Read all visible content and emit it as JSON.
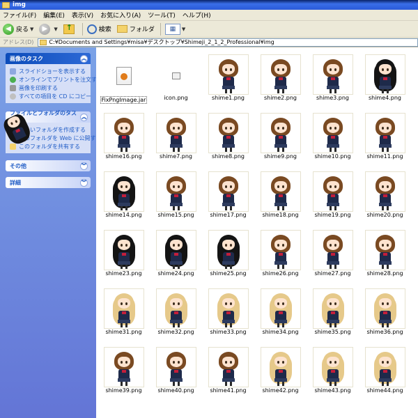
{
  "window": {
    "title": "img"
  },
  "menu": [
    "ファイル(F)",
    "編集(E)",
    "表示(V)",
    "お気に入り(A)",
    "ツール(T)",
    "ヘルプ(H)"
  ],
  "toolbar": {
    "back_label": "戻る",
    "search_label": "検索",
    "folders_label": "フォルダ"
  },
  "address": {
    "label": "アドレス(D)",
    "path": "C:¥Documents and Settings¥misa¥デスクトップ¥Shimeji_2_1_2_Professional¥img"
  },
  "left": {
    "image_tasks": {
      "title": "画像のタスク",
      "links": [
        "スライドショーを表示する",
        "オンラインでプリントを注文する",
        "画像を印刷する",
        "すべての項目を CD にコピー"
      ]
    },
    "file_tasks": {
      "title": "ファイルとフォルダのタスク",
      "links": [
        "新しいフォルダを作成する",
        "このフォルダを Web に公開する",
        "このフォルダを共有する"
      ]
    },
    "other": {
      "title": "その他"
    },
    "details": {
      "title": "詳細"
    }
  },
  "colors": {
    "brown_hair": "#7a4a22",
    "black_hair": "#141414",
    "blonde_hair": "#e6c98a",
    "selection": "#316ac5"
  },
  "files": [
    {
      "name": "FixPngImage.jar",
      "kind": "jar"
    },
    {
      "name": "icon.png",
      "kind": "png"
    },
    {
      "name": "shime1.png",
      "kind": "brown"
    },
    {
      "name": "shime2.png",
      "kind": "brown"
    },
    {
      "name": "shime3.png",
      "kind": "brown"
    },
    {
      "name": "shime4.png",
      "kind": "black"
    },
    {
      "name": "shime16.png",
      "kind": "brown"
    },
    {
      "name": "shime7.png",
      "kind": "brown"
    },
    {
      "name": "shime8.png",
      "kind": "brown"
    },
    {
      "name": "shime9.png",
      "kind": "brown"
    },
    {
      "name": "shime10.png",
      "kind": "brown"
    },
    {
      "name": "shime11.png",
      "kind": "brown"
    },
    {
      "name": "shime14.png",
      "kind": "black"
    },
    {
      "name": "shime15.png",
      "kind": "brown"
    },
    {
      "name": "shime17.png",
      "kind": "brown"
    },
    {
      "name": "shime18.png",
      "kind": "brown"
    },
    {
      "name": "shime19.png",
      "kind": "brown"
    },
    {
      "name": "shime20.png",
      "kind": "brown"
    },
    {
      "name": "shime23.png",
      "kind": "black"
    },
    {
      "name": "shime24.png",
      "kind": "black"
    },
    {
      "name": "shime25.png",
      "kind": "black"
    },
    {
      "name": "shime26.png",
      "kind": "brown"
    },
    {
      "name": "shime27.png",
      "kind": "brown"
    },
    {
      "name": "shime28.png",
      "kind": "brown"
    },
    {
      "name": "shime31.png",
      "kind": "blonde"
    },
    {
      "name": "shime32.png",
      "kind": "blonde"
    },
    {
      "name": "shime33.png",
      "kind": "blonde"
    },
    {
      "name": "shime34.png",
      "kind": "blonde"
    },
    {
      "name": "shime35.png",
      "kind": "blonde"
    },
    {
      "name": "shime36.png",
      "kind": "blonde"
    },
    {
      "name": "shime39.png",
      "kind": "brown"
    },
    {
      "name": "shime40.png",
      "kind": "brown"
    },
    {
      "name": "shime41.png",
      "kind": "brown"
    },
    {
      "name": "shime42.png",
      "kind": "blonde"
    },
    {
      "name": "shime43.png",
      "kind": "blonde"
    },
    {
      "name": "shime44.png",
      "kind": "blonde"
    }
  ]
}
